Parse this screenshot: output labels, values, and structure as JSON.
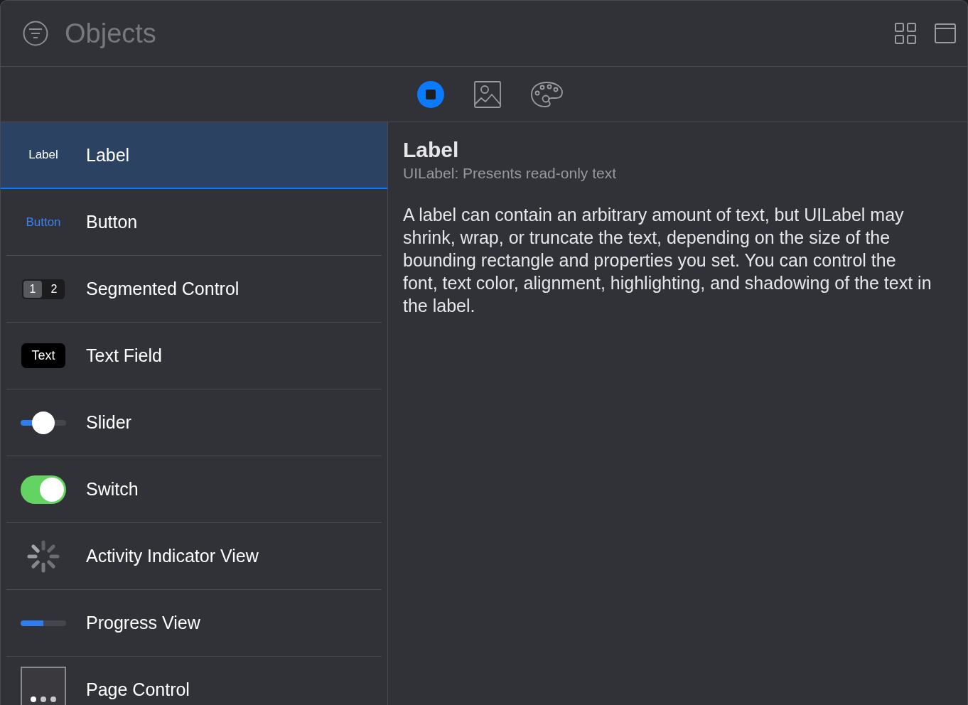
{
  "window": {
    "title": "Objects"
  },
  "library_tabs": [
    {
      "kind": "objects",
      "selected": true
    },
    {
      "kind": "media",
      "selected": false
    },
    {
      "kind": "colors",
      "selected": false
    }
  ],
  "items": [
    {
      "kind": "label",
      "preview": "Label",
      "name": "Label",
      "selected": true
    },
    {
      "kind": "button",
      "preview": "Button",
      "name": "Button",
      "selected": false
    },
    {
      "kind": "segmented",
      "segments": [
        {
          "label": "1",
          "selected": true
        },
        {
          "label": "2",
          "selected": false
        }
      ],
      "name": "Segmented Control",
      "selected": false
    },
    {
      "kind": "text_field",
      "preview": "Text",
      "name": "Text Field",
      "selected": false
    },
    {
      "kind": "slider",
      "level": 0.5,
      "name": "Slider",
      "selected": false
    },
    {
      "kind": "switch",
      "on": true,
      "name": "Switch",
      "selected": false
    },
    {
      "kind": "activity",
      "name": "Activity Indicator View",
      "selected": false
    },
    {
      "kind": "progress",
      "level": 0.5,
      "name": "Progress View",
      "selected": false
    },
    {
      "kind": "page_control",
      "name": "Page Control",
      "selected": false
    }
  ],
  "detail": {
    "title": "Label",
    "subtitle": "UILabel: Presents read-only text",
    "description": "A label can contain an arbitrary amount of text, but UILabel may shrink, wrap, or truncate the text, depending on the size of the bounding rectangle and properties you set. You can control the font, text color, alignment, highlighting, and shadowing of the text in the label."
  }
}
